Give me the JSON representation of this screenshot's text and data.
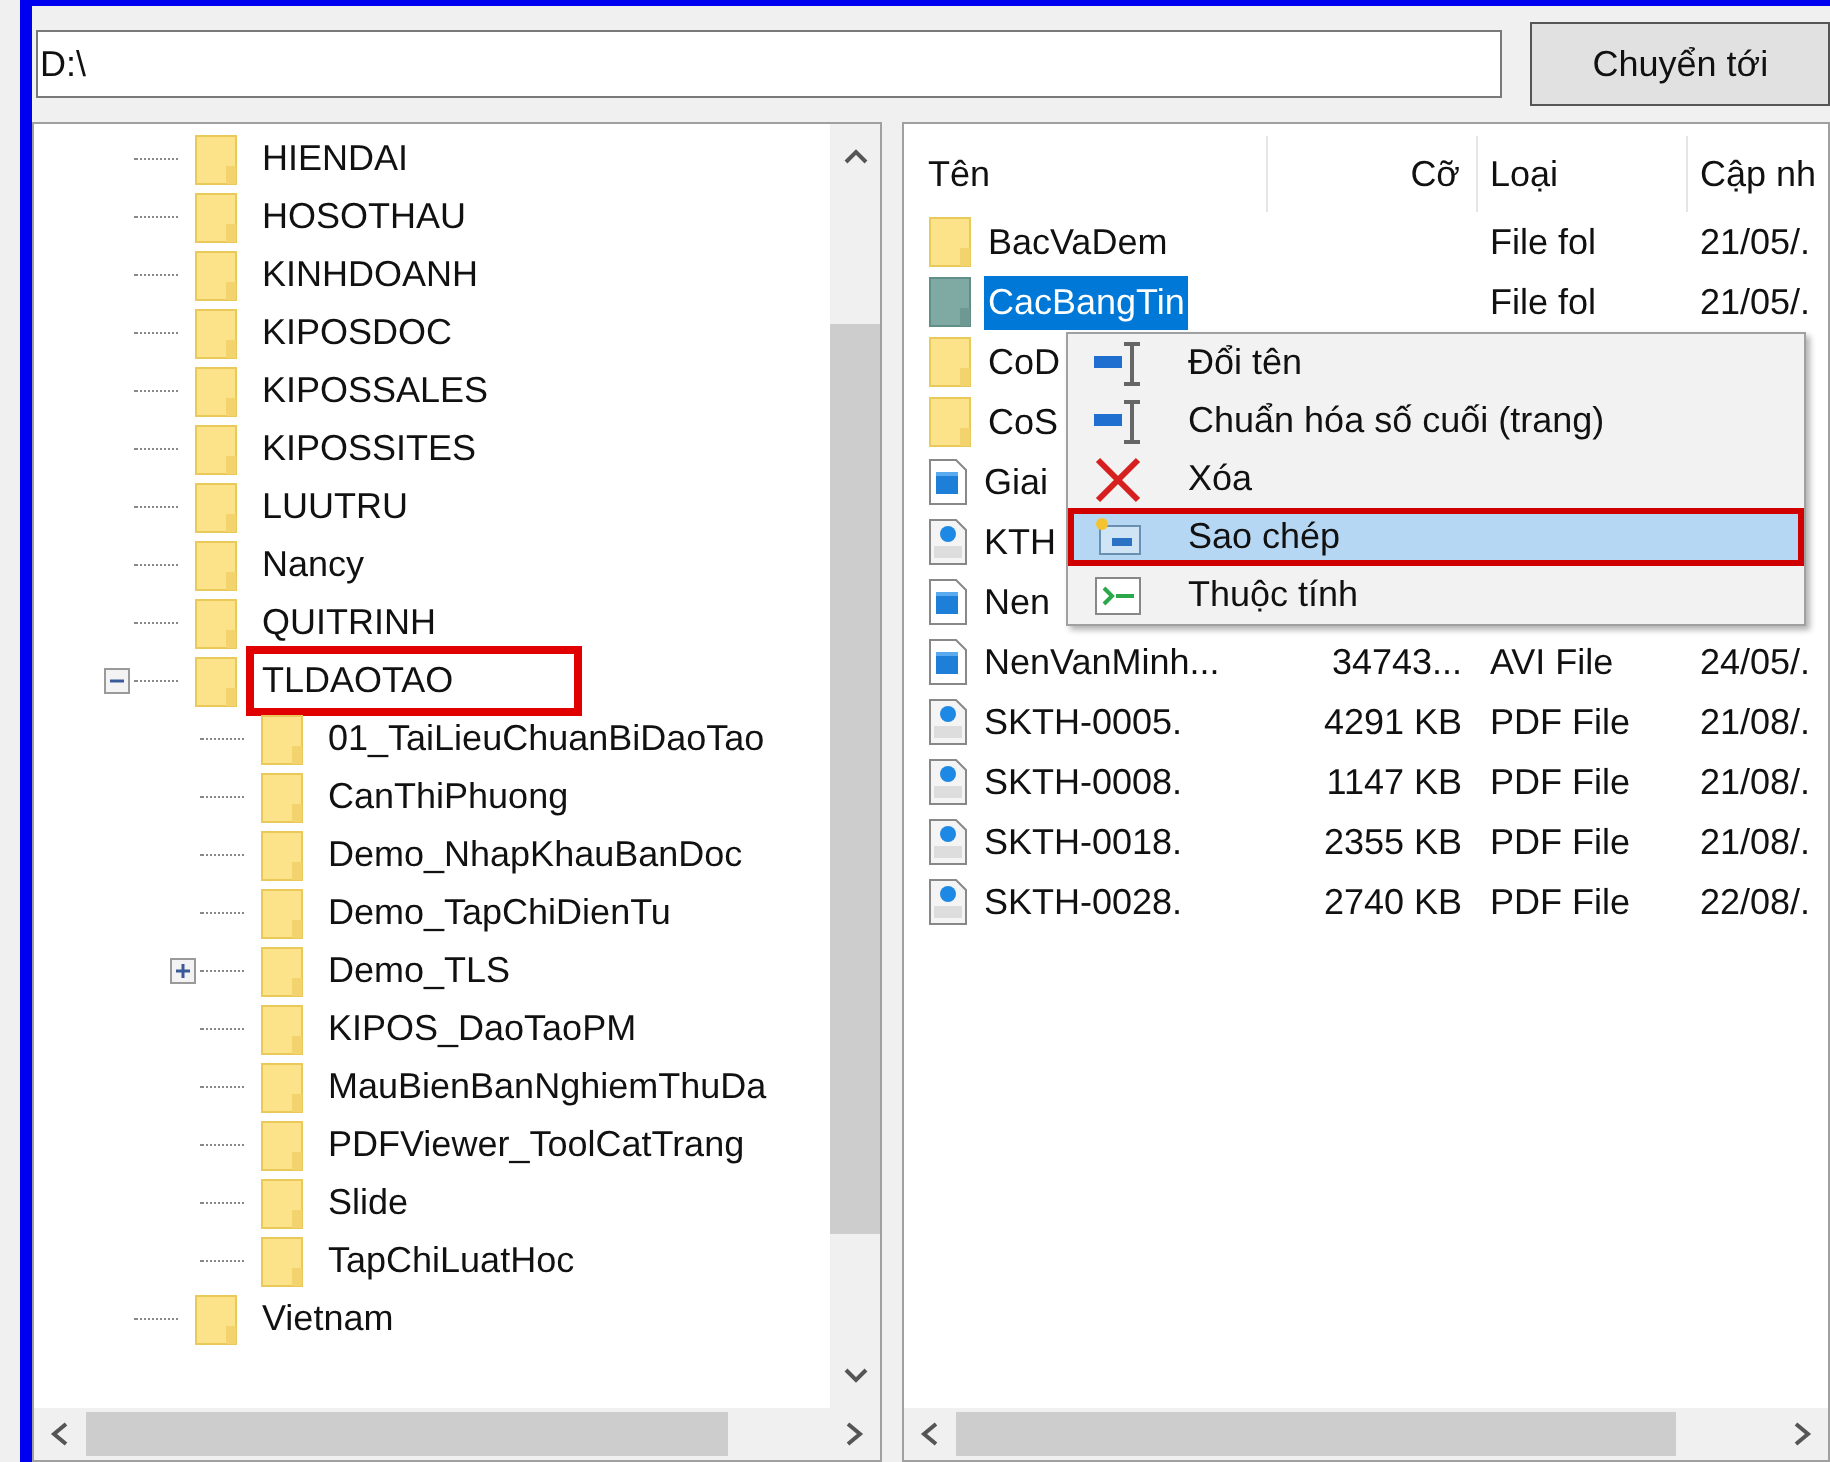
{
  "address_bar": {
    "value": "D:\\",
    "button": "Chuyển tới"
  },
  "tree": [
    {
      "kind": "leaf",
      "label": "HIENDAI",
      "highlighted": false
    },
    {
      "kind": "leaf",
      "label": "HOSOTHAU",
      "highlighted": false
    },
    {
      "kind": "leaf",
      "label": "KINHDOANH",
      "highlighted": false
    },
    {
      "kind": "leaf",
      "label": "KIPOSDOC",
      "highlighted": false
    },
    {
      "kind": "leaf",
      "label": "KIPOSSALES",
      "highlighted": false
    },
    {
      "kind": "leaf",
      "label": "KIPOSSITES",
      "highlighted": false
    },
    {
      "kind": "leaf",
      "label": "LUUTRU",
      "highlighted": false
    },
    {
      "kind": "leaf",
      "label": "Nancy",
      "highlighted": false
    },
    {
      "kind": "leaf",
      "label": "QUITRINH",
      "highlighted": false
    },
    {
      "kind": "node",
      "label": "TLDAOTAO",
      "expanded": true,
      "highlighted": true,
      "children": [
        {
          "kind": "leaf",
          "label": "01_TaiLieuChuanBiDaoTao",
          "highlighted": false
        },
        {
          "kind": "leaf",
          "label": "CanThiPhuong",
          "highlighted": false
        },
        {
          "kind": "leaf",
          "label": "Demo_NhapKhauBanDoc",
          "highlighted": false
        },
        {
          "kind": "leaf",
          "label": "Demo_TapChiDienTu",
          "highlighted": false
        },
        {
          "kind": "node",
          "label": "Demo_TLS",
          "expanded": false,
          "highlighted": false
        },
        {
          "kind": "leaf",
          "label": "KIPOS_DaoTaoPM",
          "highlighted": false
        },
        {
          "kind": "leaf",
          "label": "MauBienBanNghiemThuDa",
          "highlighted": false
        },
        {
          "kind": "leaf",
          "label": "PDFViewer_ToolCatTrang",
          "highlighted": false
        },
        {
          "kind": "leaf",
          "label": "Slide",
          "highlighted": false
        },
        {
          "kind": "leaf",
          "label": "TapChiLuatHoc",
          "highlighted": false
        }
      ]
    },
    {
      "kind": "leaf",
      "label": "Vietnam",
      "highlighted": false
    }
  ],
  "file_list": {
    "columns": [
      "Tên",
      "Cỡ",
      "Loại",
      "Cập nh"
    ],
    "rows": [
      {
        "kind": "folder",
        "name": "BacVaDem",
        "type": "File fol",
        "date": "21/05/.",
        "selected": false
      },
      {
        "kind": "folder",
        "name": "CacBangTin",
        "type": "File fol",
        "date": "21/05/.",
        "selected": true
      },
      {
        "kind": "folder",
        "name": "CoD",
        "selected": false
      },
      {
        "kind": "folder",
        "name": "CoS",
        "selected": false
      },
      {
        "kind": "video",
        "name": "Giai",
        "selected": false
      },
      {
        "kind": "pdf",
        "name": "KTH",
        "selected": false
      },
      {
        "kind": "video",
        "name": "Nen",
        "selected": false
      },
      {
        "kind": "video",
        "name": "NenVanMinh...",
        "size": "34743...",
        "type": "AVI File",
        "date": "24/05/.",
        "selected": false
      },
      {
        "kind": "pdf",
        "name": "SKTH-0005.",
        "size": "4291 KB",
        "type": "PDF File",
        "date": "21/08/.",
        "selected": false
      },
      {
        "kind": "pdf",
        "name": "SKTH-0008.",
        "size": "1147 KB",
        "type": "PDF File",
        "date": "21/08/.",
        "selected": false
      },
      {
        "kind": "pdf",
        "name": "SKTH-0018.",
        "size": "2355 KB",
        "type": "PDF File",
        "date": "21/08/.",
        "selected": false
      },
      {
        "kind": "pdf",
        "name": "SKTH-0028.",
        "size": "2740 KB",
        "type": "PDF File",
        "date": "22/08/.",
        "selected": false
      }
    ]
  },
  "context_menu": [
    {
      "kind": "rename",
      "label": "Đổi tên",
      "selected": false
    },
    {
      "kind": "rename",
      "label": "Chuẩn hóa số cuối (trang)",
      "selected": false
    },
    {
      "kind": "delete",
      "label": "Xóa",
      "selected": false
    },
    {
      "kind": "copy",
      "label": "Sao chép",
      "selected": true
    },
    {
      "kind": "properties",
      "label": "Thuộc tính",
      "selected": false
    }
  ]
}
